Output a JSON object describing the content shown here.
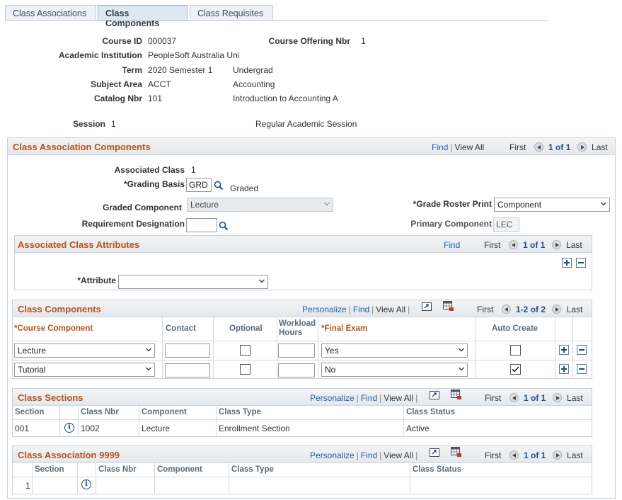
{
  "tabs": [
    "Class Associations",
    "Class Components",
    "Class Requisites"
  ],
  "header": {
    "course_id_label": "Course ID",
    "course_id": "000037",
    "offering_label": "Course Offering Nbr",
    "offering": "1",
    "institution_label": "Academic Institution",
    "institution": "PeopleSoft Australia Uni",
    "term_label": "Term",
    "term": "2020 Semester 1",
    "career": "Undergrad",
    "subject_label": "Subject Area",
    "subject": "ACCT",
    "subject_desc": "Accounting",
    "catalog_label": "Catalog Nbr",
    "catalog": "101",
    "catalog_desc": "Introduction to Accounting A",
    "session_label": "Session",
    "session": "1",
    "session_desc": "Regular Academic Session"
  },
  "assoc_components": {
    "title": "Class Association Components",
    "find": "Find",
    "view_all": "View All",
    "first": "First",
    "count": "1 of 1",
    "last": "Last",
    "assoc_class_label": "Associated Class",
    "assoc_class": "1",
    "grading_basis_label": "*Grading Basis",
    "grading_basis": "GRD",
    "grading_basis_desc": "Graded",
    "graded_component_label": "Graded Component",
    "graded_component": "Lecture",
    "grade_roster_label": "*Grade Roster Print",
    "grade_roster": "Component",
    "req_designation_label": "Requirement Designation",
    "req_designation": "",
    "primary_component_label": "Primary Component",
    "primary_component": "LEC"
  },
  "attributes": {
    "title": "Associated Class Attributes",
    "find": "Find",
    "first": "First",
    "count": "1 of 1",
    "last": "Last",
    "attribute_label": "*Attribute",
    "attribute": ""
  },
  "class_components": {
    "title": "Class Components",
    "personalize": "Personalize",
    "find": "Find",
    "view_all": "View All",
    "first": "First",
    "count": "1-2 of 2",
    "last": "Last",
    "columns": [
      "*Course Component",
      "Contact",
      "Optional",
      "Workload Hours",
      "*Final Exam",
      "Auto Create"
    ],
    "workload_line1": "Workload",
    "workload_line2": "Hours",
    "rows": [
      {
        "component": "Lecture",
        "contact": "",
        "optional": false,
        "workload": "",
        "final_exam": "Yes",
        "auto_create": false
      },
      {
        "component": "Tutorial",
        "contact": "",
        "optional": false,
        "workload": "",
        "final_exam": "No",
        "auto_create": true
      }
    ]
  },
  "class_sections": {
    "title": "Class Sections",
    "personalize": "Personalize",
    "find": "Find",
    "view_all": "View All",
    "first": "First",
    "count": "1 of 1",
    "last": "Last",
    "columns": [
      "Section",
      "Class Nbr",
      "Component",
      "Class Type",
      "Class Status"
    ],
    "rows": [
      {
        "section": "001",
        "class_nbr": "1002",
        "component": "Lecture",
        "class_type": "Enrollment Section",
        "class_status": "Active"
      }
    ]
  },
  "class_assoc_9999": {
    "title": "Class Association 9999",
    "personalize": "Personalize",
    "find": "Find",
    "view_all": "View All",
    "first": "First",
    "count": "1 of 1",
    "last": "Last",
    "columns": [
      "Section",
      "Class Nbr",
      "Component",
      "Class Type",
      "Class Status"
    ],
    "rows": [
      {
        "num": "1",
        "section": "",
        "class_nbr": "",
        "component": "",
        "class_type": "",
        "class_status": ""
      }
    ]
  },
  "colors": {
    "title_orange": "#b5521c",
    "link_blue": "#1e5ea8"
  }
}
